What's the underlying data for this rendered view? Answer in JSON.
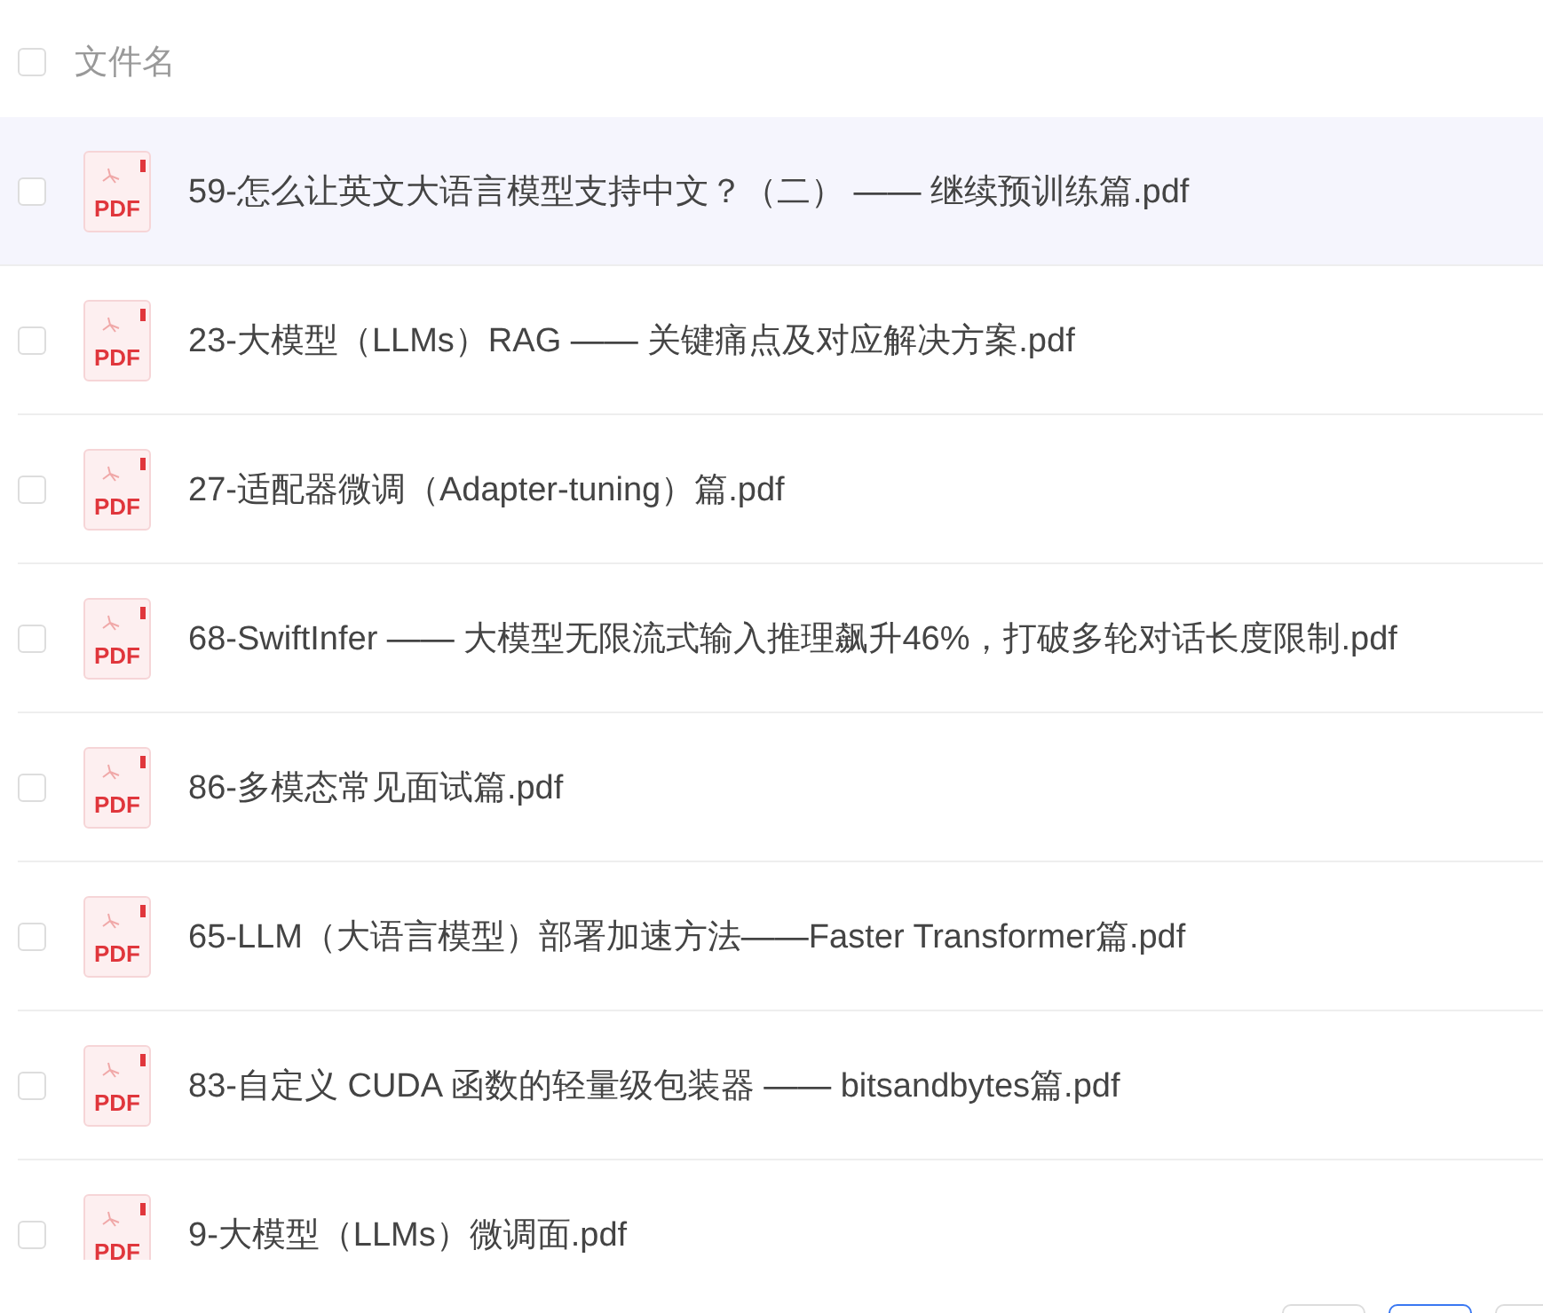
{
  "header": {
    "checked": false,
    "label": "文件名"
  },
  "files": [
    {
      "name": "59-怎么让英文大语言模型支持中文？（二） —— 继续预训练篇.pdf",
      "icon_text": "PDF",
      "checked": false,
      "highlighted": true
    },
    {
      "name": "23-大模型（LLMs）RAG —— 关键痛点及对应解决方案.pdf",
      "icon_text": "PDF",
      "checked": false,
      "highlighted": false
    },
    {
      "name": "27-适配器微调（Adapter-tuning）篇.pdf",
      "icon_text": "PDF",
      "checked": false,
      "highlighted": false
    },
    {
      "name": "68-SwiftInfer —— 大模型无限流式输入推理飙升46%，打破多轮对话长度限制.pdf",
      "icon_text": "PDF",
      "checked": false,
      "highlighted": false
    },
    {
      "name": "86-多模态常见面试篇.pdf",
      "icon_text": "PDF",
      "checked": false,
      "highlighted": false
    },
    {
      "name": "65-LLM（大语言模型）部署加速方法——Faster Transformer篇.pdf",
      "icon_text": "PDF",
      "checked": false,
      "highlighted": false
    },
    {
      "name": "83-自定义 CUDA 函数的轻量级包装器 —— bitsandbytes篇.pdf",
      "icon_text": "PDF",
      "checked": false,
      "highlighted": false
    },
    {
      "name": "9-大模型（LLMs）微调面.pdf",
      "icon_text": "PDF",
      "checked": false,
      "highlighted": false
    }
  ],
  "pagination": [
    {
      "selected": false
    },
    {
      "selected": true
    },
    {
      "selected": false
    }
  ]
}
